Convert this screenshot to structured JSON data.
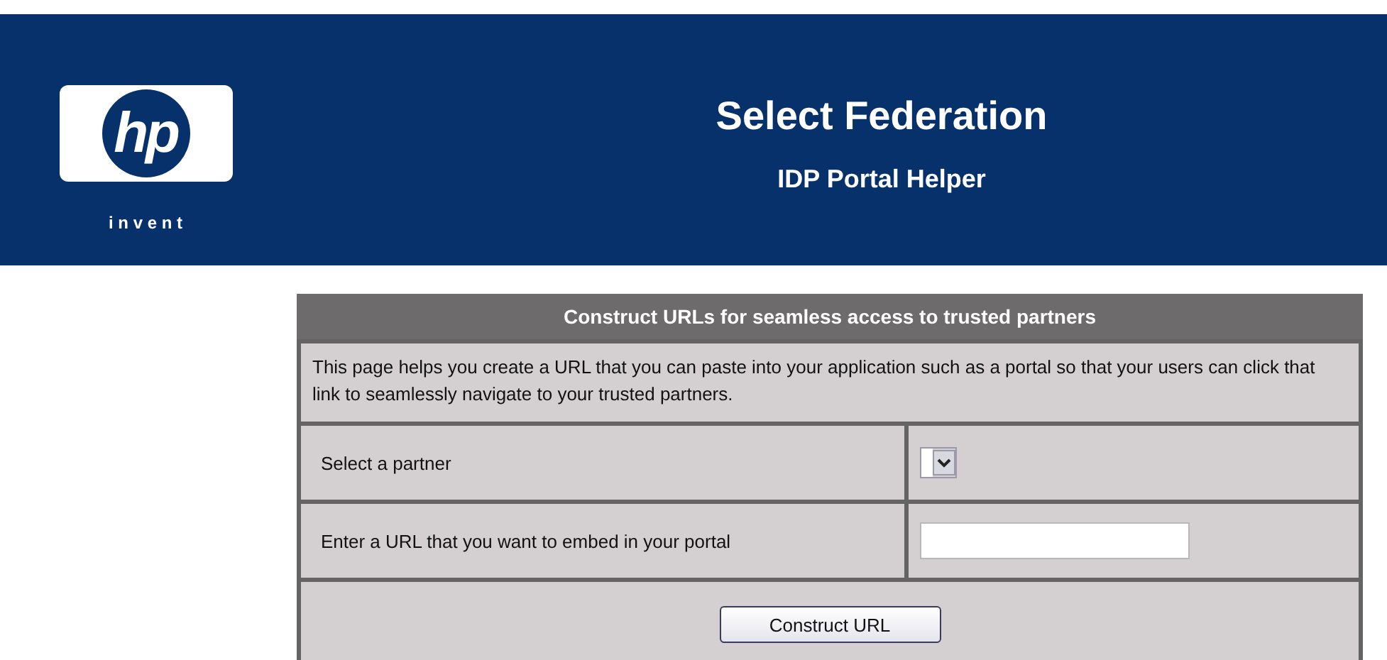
{
  "header": {
    "logo": {
      "mark": "hp",
      "tagline": "i n v e n t"
    },
    "title": "Select Federation",
    "subtitle": "IDP Portal Helper"
  },
  "panel": {
    "heading": "Construct URLs for seamless access to trusted partners",
    "description": "This page helps you create a URL that you can paste into your application such as a portal so that your users can click that link to seamlessly navigate to your trusted partners.",
    "rows": [
      {
        "label": "Select a partner",
        "kind": "select"
      },
      {
        "label": "Enter a URL that you want to embed in your portal",
        "kind": "text"
      }
    ],
    "button": "Construct URL"
  }
}
